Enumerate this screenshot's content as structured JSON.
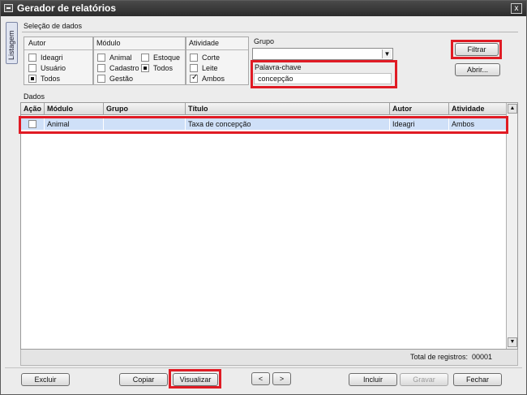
{
  "window": {
    "title": "Gerador de relatórios",
    "close_label": "x"
  },
  "sidetab": {
    "label": "Listagem"
  },
  "selection": {
    "section_title": "Seleção de dados",
    "autor": {
      "title": "Autor",
      "options": [
        {
          "label": "Ideagri",
          "state": "unchecked"
        },
        {
          "label": "Usuário",
          "state": "unchecked"
        },
        {
          "label": "Todos",
          "state": "filled"
        }
      ]
    },
    "modulo": {
      "title": "Módulo",
      "options": [
        {
          "label": "Animal",
          "state": "unchecked"
        },
        {
          "label": "Estoque",
          "state": "unchecked"
        },
        {
          "label": "Cadastro",
          "state": "unchecked"
        },
        {
          "label": "Todos",
          "state": "filled"
        },
        {
          "label": "Gestão",
          "state": "unchecked"
        }
      ]
    },
    "atividade": {
      "title": "Atividade",
      "options": [
        {
          "label": "Corte",
          "state": "unchecked"
        },
        {
          "label": "Leite",
          "state": "unchecked"
        },
        {
          "label": "Ambos",
          "state": "checked"
        }
      ]
    },
    "grupo": {
      "title": "Grupo",
      "value": ""
    },
    "keyword": {
      "title": "Palavra-chave",
      "value": "concepção"
    },
    "buttons": {
      "filter": "Filtrar",
      "open": "Abrir..."
    }
  },
  "data": {
    "section_title": "Dados",
    "columns": [
      "Ação",
      "Módulo",
      "Grupo",
      "Título",
      "Autor",
      "Atividade"
    ],
    "rows": [
      {
        "acao": "",
        "modulo": "Animal",
        "grupo": "",
        "titulo": "Taxa de concepção",
        "autor": "Ideagri",
        "atividade": "Ambos"
      }
    ],
    "total_label": "Total de registros:",
    "total_value": "00001"
  },
  "footer": {
    "excluir": "Excluir",
    "copiar": "Copiar",
    "visualizar": "Visualizar",
    "prev": "<",
    "next": ">",
    "incluir": "Incluir",
    "gravar": "Gravar",
    "fechar": "Fechar"
  },
  "colors": {
    "highlight": "#e01b24",
    "row_selected": "#cfe0f8",
    "titlebar": "#2b2b2b"
  }
}
